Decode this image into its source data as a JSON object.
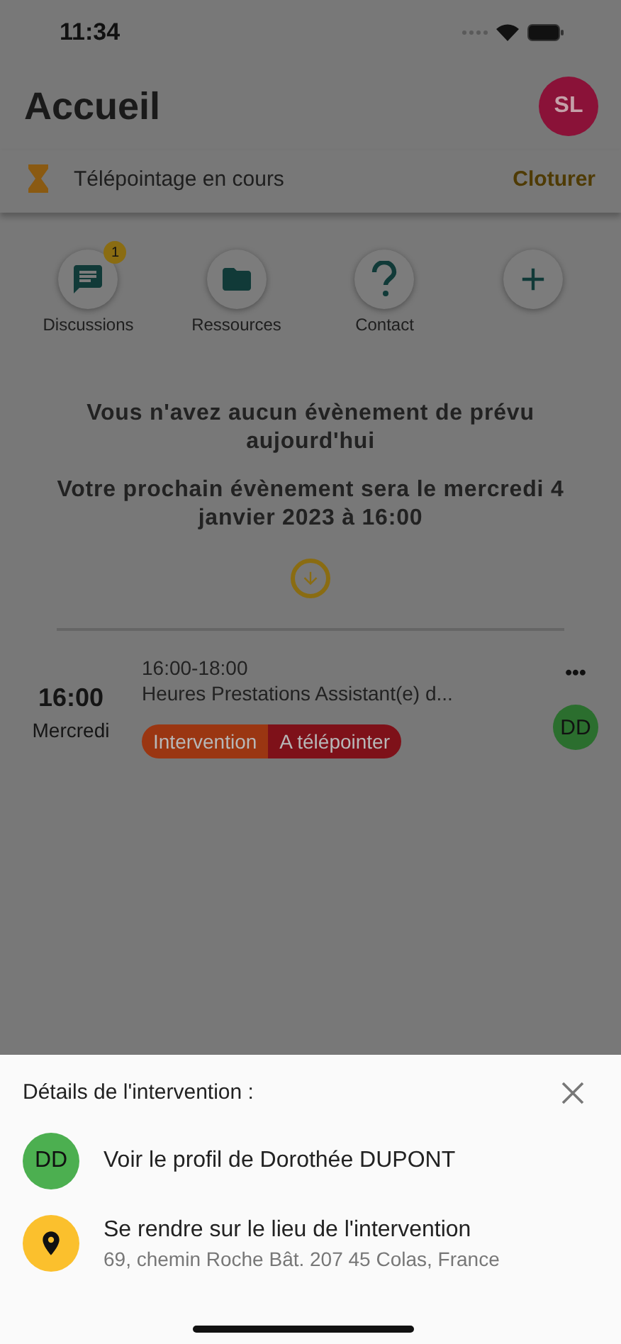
{
  "status_bar": {
    "time": "11:34"
  },
  "header": {
    "title": "Accueil",
    "avatar": "SL"
  },
  "telepointage": {
    "label": "Télépointage en cours",
    "action": "Cloturer"
  },
  "shortcuts": [
    {
      "kind": "chat",
      "label": "Discussions",
      "badge": "1"
    },
    {
      "kind": "folder",
      "label": "Ressources"
    },
    {
      "kind": "help",
      "label": "Contact"
    },
    {
      "kind": "add"
    }
  ],
  "messages": [
    "Vous n'avez aucun évènement de prévu aujourd'hui",
    "Votre prochain évènement sera le mercredi 4 janvier 2023 à 16:00"
  ],
  "event": {
    "time": "16:00",
    "day": "Mercredi",
    "hours": "16:00-18:00",
    "title": "Heures Prestations Assistant(e) d...",
    "more": "•••",
    "avatar": "DD",
    "tags": [
      {
        "label": "Intervention",
        "color": "#9a3612"
      },
      {
        "label": "A télépointer",
        "color": "#7e1119"
      }
    ]
  },
  "sheet": {
    "title": "Détails de l'intervention :",
    "items": [
      {
        "kind": "profile",
        "avatar": "DD",
        "label": "Voir le profil de Dorothée DUPONT"
      },
      {
        "kind": "location",
        "label": "Se rendre sur le lieu de l'intervention",
        "detail": "69, chemin Roche Bât. 207 45 Colas, France"
      }
    ]
  }
}
